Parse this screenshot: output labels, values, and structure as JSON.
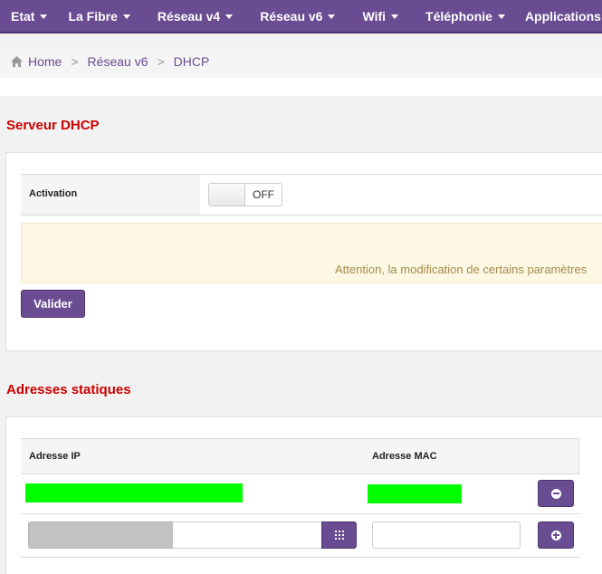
{
  "nav": {
    "items": [
      {
        "label": "Etat"
      },
      {
        "label": "La Fibre"
      },
      {
        "label": "Réseau v4"
      },
      {
        "label": "Réseau v6"
      },
      {
        "label": "Wifi"
      },
      {
        "label": "Téléphonie"
      },
      {
        "label": "Applications"
      }
    ]
  },
  "breadcrumb": {
    "home": "Home",
    "separator": ">",
    "level1": "Réseau v6",
    "level2": "DHCP"
  },
  "dhcp_server": {
    "title": "Serveur DHCP",
    "activation_label": "Activation",
    "toggle_state": "OFF",
    "toggle_on": false,
    "warning": "Attention, la modification de certains paramètres",
    "submit_label": "Valider"
  },
  "static_addresses": {
    "title": "Adresses statiques",
    "columns": [
      "Adresse IP",
      "Adresse MAC"
    ],
    "new_ip_value": "",
    "new_mac_value": ""
  },
  "colors": {
    "brand": "#6a4c93",
    "section_title": "#cc0000",
    "warning_bg": "#fcf8e3",
    "warning_text": "#a58a4e",
    "redaction": "#00ff00"
  },
  "icons": {
    "home": "home-icon",
    "remove": "minus-circle-icon",
    "add": "plus-circle-icon",
    "keypad": "grid-icon"
  }
}
